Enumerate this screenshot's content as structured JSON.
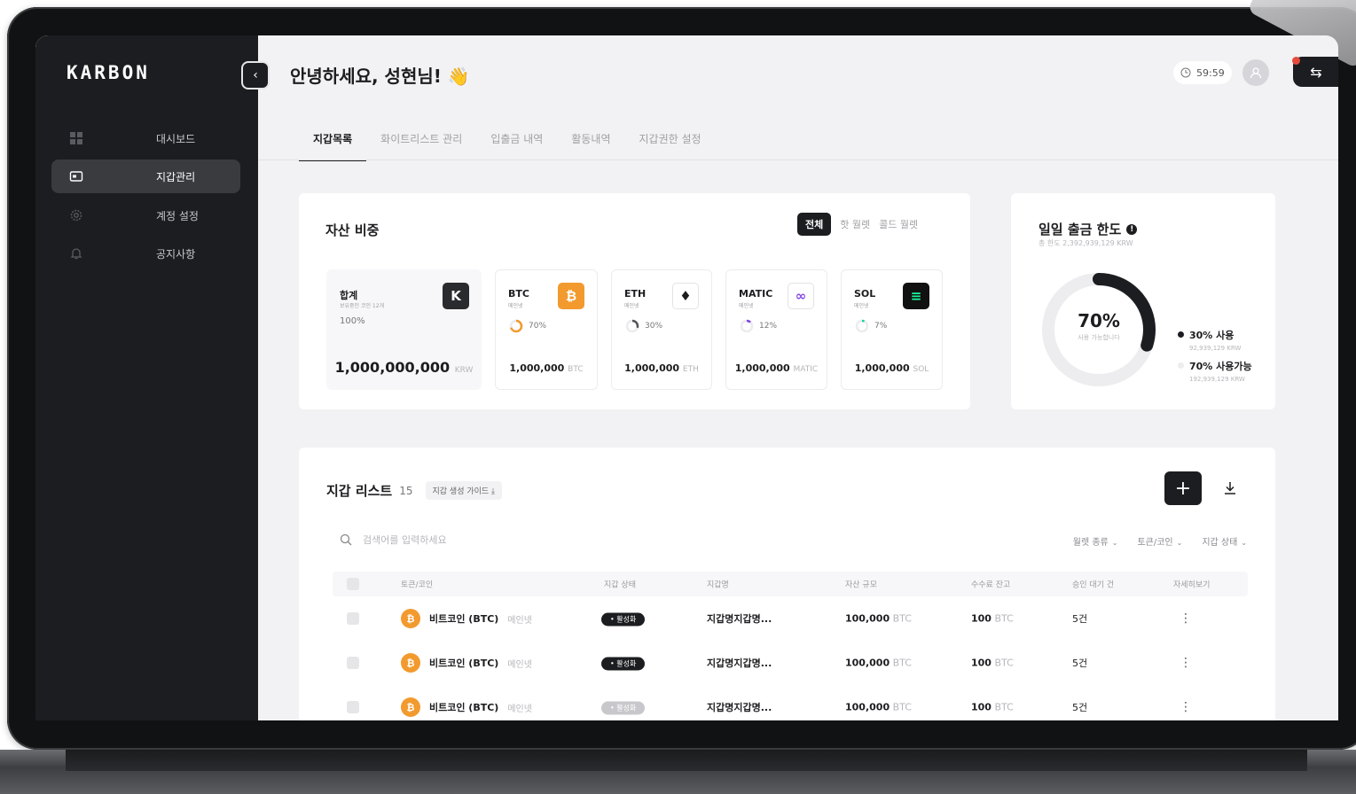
{
  "app": {
    "logo": "KARBON"
  },
  "sidebar": {
    "items": [
      {
        "label": "대시보드",
        "icon": "dashboard-icon",
        "active": false
      },
      {
        "label": "지갑관리",
        "icon": "wallet-icon",
        "active": true
      },
      {
        "label": "계정 설정",
        "icon": "gear-icon",
        "active": false
      },
      {
        "label": "공지사항",
        "icon": "bell-icon",
        "active": false
      }
    ]
  },
  "header": {
    "greeting": "안녕하세요, 성현님! 👋",
    "timer": "59:59"
  },
  "tabs": [
    "지갑목록",
    "화이트리스트 관리",
    "입출금 내역",
    "활동내역",
    "지갑권한 설정"
  ],
  "assets_card": {
    "title": "자산 비중",
    "filters": [
      "전체",
      "핫 월렛",
      "콜드 월렛"
    ],
    "total": {
      "name": "합계",
      "sub": "보유중인 코인 12개",
      "pct": "100%",
      "amount": "1,000,000,000",
      "unit": "KRW",
      "icon_letter": "K"
    },
    "coins": [
      {
        "name": "BTC",
        "sub": "메인넷",
        "pct": "70%",
        "amount": "1,000,000",
        "unit": "BTC",
        "icon": "₿",
        "icon_bg": "#f29a2e",
        "icon_fg": "#ffffff",
        "ring_color": "#f29a2e",
        "fraction": 0.7
      },
      {
        "name": "ETH",
        "sub": "메인넷",
        "pct": "30%",
        "amount": "1,000,000",
        "unit": "ETH",
        "icon": "♦",
        "icon_bg": "#ffffff",
        "icon_fg": "#1d1d20",
        "ring_color": "#555558",
        "fraction": 0.3
      },
      {
        "name": "MATIC",
        "sub": "메인넷",
        "pct": "12%",
        "amount": "1,000,000",
        "unit": "MATIC",
        "icon": "∞",
        "icon_bg": "#ffffff",
        "icon_fg": "#8247e5",
        "ring_color": "#8247e5",
        "fraction": 0.12
      },
      {
        "name": "SOL",
        "sub": "메인넷",
        "pct": "7%",
        "amount": "1,000,000",
        "unit": "SOL",
        "icon": "≡",
        "icon_bg": "#111111",
        "icon_fg": "#19fb9b",
        "ring_color": "#19d3a0",
        "fraction": 0.07
      }
    ]
  },
  "daily_limit": {
    "title": "일일 출금 한도",
    "sub": "총 한도 2,392,939,129 KRW",
    "pct": "70%",
    "note": "사용 가능합니다",
    "used_fraction": 0.3,
    "legend": [
      {
        "label": "30% 사용",
        "sub": "92,939,129 KRW",
        "color": "#1c1d20"
      },
      {
        "label": "70% 사용가능",
        "sub": "192,939,129 KRW",
        "color": "#ededf0"
      }
    ]
  },
  "wallet_list": {
    "title": "지갑 리스트",
    "count": "15",
    "guide": "지갑 생성 가이드 ⤓",
    "search_placeholder": "검색어를 입력하세요",
    "dropdowns": [
      "월렛 종류",
      "토큰/코인",
      "지갑 상태"
    ],
    "columns": [
      "토큰/코인",
      "지갑 상태",
      "지갑명",
      "자산 규모",
      "수수료 잔고",
      "승인 대기 건",
      "자세히보기"
    ],
    "rows": [
      {
        "coin": "비트코인 (BTC)",
        "net": "메인넷",
        "status": "활성화",
        "active": true,
        "name": "지갑명지갑명...",
        "amount": "100,000",
        "unit": "BTC",
        "fee": "100",
        "fee_unit": "BTC",
        "pending": "5건"
      },
      {
        "coin": "비트코인 (BTC)",
        "net": "메인넷",
        "status": "활성화",
        "active": true,
        "name": "지갑명지갑명...",
        "amount": "100,000",
        "unit": "BTC",
        "fee": "100",
        "fee_unit": "BTC",
        "pending": "5건"
      },
      {
        "coin": "비트코인 (BTC)",
        "net": "메인넷",
        "status": "활성화",
        "active": false,
        "name": "지갑명지갑명...",
        "amount": "100,000",
        "unit": "BTC",
        "fee": "100",
        "fee_unit": "BTC",
        "pending": "5건"
      }
    ]
  }
}
